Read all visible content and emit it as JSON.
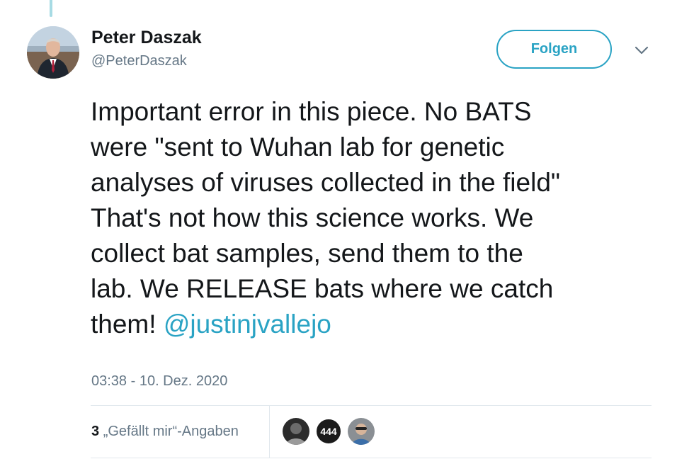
{
  "tweet": {
    "author": {
      "display_name": "Peter Daszak",
      "handle": "@PeterDaszak"
    },
    "follow_label": "Folgen",
    "text_lines": [
      "Important error in this piece. No BATS",
      "were \"sent to Wuhan lab for genetic",
      "analyses of viruses collected in the field\"",
      "That's not how this science works. We",
      "collect bat samples, send them to the",
      "lab. We RELEASE bats where we catch"
    ],
    "text_last_line": "them!",
    "mention": "@justinjvallejo",
    "timestamp": "03:38 - 10. Dez. 2020",
    "likes_count": "3",
    "likes_label": "„Gefällt mir“-Angaben",
    "likers": [
      {
        "name": "liker-avatar-1"
      },
      {
        "name": "liker-avatar-2",
        "badge": "444"
      },
      {
        "name": "liker-avatar-3"
      }
    ]
  },
  "colors": {
    "accent": "#2aa3c4",
    "secondary_text": "#657786",
    "primary_text": "#14171a",
    "divider": "#e1e8ed",
    "thread_line": "#a7dbe4"
  }
}
